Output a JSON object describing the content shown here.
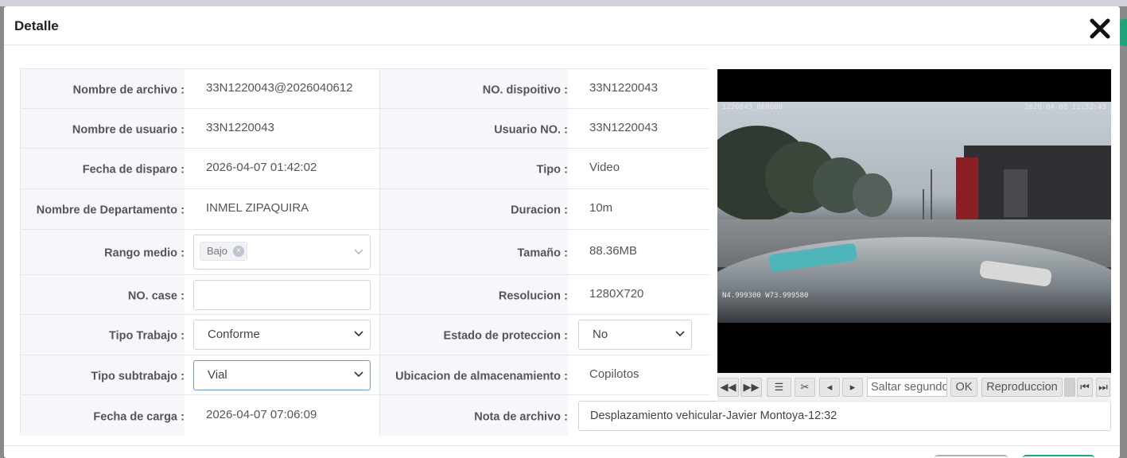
{
  "dialog": {
    "title": "Detalle"
  },
  "details": {
    "labels": {
      "file_name": "Nombre de archivo",
      "user_name": "Nombre de usuario",
      "capture_date": "Fecha de disparo",
      "department": "Nombre de Departamento",
      "medium_range": "Rango medio",
      "case_no": "NO. case",
      "work_type": "Tipo Trabajo",
      "subwork_type": "Tipo subtrabajo",
      "upload_date": "Fecha de carga",
      "device_no": "NO. dispoitivo",
      "user_no": "Usuario NO.",
      "type": "Tipo",
      "duration": "Duracion",
      "size": "Tamaño",
      "resolution": "Resolucion",
      "protection": "Estado de proteccion",
      "storage": "Ubicacion de almacenamiento",
      "file_note": "Nota de archivo"
    },
    "values": {
      "file_name": "33N1220043@2026040612",
      "user_name": "33N1220043",
      "capture_date": "2026-04-07 01:42:02",
      "department": "INMEL ZIPAQUIRA",
      "medium_range_tag": "Bajo",
      "case_no": "",
      "work_type": "Conforme",
      "subwork_type": "Vial",
      "upload_date": "2026-04-07 07:06:09",
      "device_no": "33N1220043",
      "user_no": "33N1220043",
      "type": "Video",
      "duration": "10m",
      "size": "88.36MB",
      "resolution": "1280X720",
      "protection": "No",
      "storage": "Copilotos",
      "file_note": "Desplazamiento vehicular-Javier Montoya-12:32"
    }
  },
  "video": {
    "overlay_top_left": "1220043_000000",
    "overlay_top_right": "2026-04-06 12:32:45",
    "overlay_coords": "N4.999300 W73.999580",
    "seek_placeholder": "Saltar segundo",
    "ok_label": "OK",
    "playback_label": "Reproduccion",
    "controls": {
      "rewind_icon": "◀◀",
      "forward_icon": "▶▶",
      "list_icon": "☰",
      "scissors_icon": "✂",
      "prev_frame_icon": "◂",
      "next_frame_icon": "▸",
      "first_icon": "⏮",
      "last_icon": "⏭"
    }
  },
  "colors": {
    "accent_green": "#1fa37a",
    "label_bg": "#f5f7fa"
  }
}
